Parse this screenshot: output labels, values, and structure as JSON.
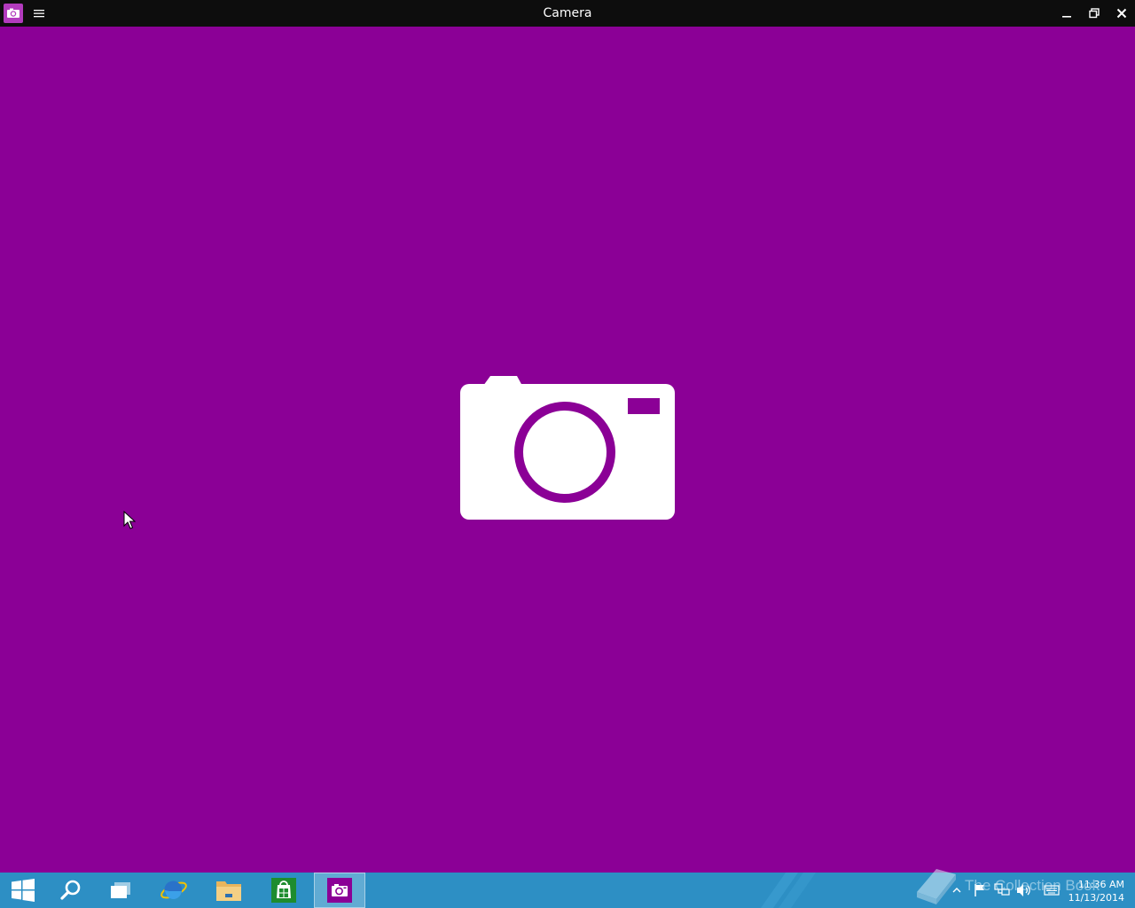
{
  "window": {
    "title": "Camera",
    "icons": {
      "app": "camera-app-icon",
      "menu": "hamburger-menu-icon",
      "minimize": "minimize-icon",
      "maximize": "restore-icon",
      "close": "close-icon"
    }
  },
  "main": {
    "background_color": "#8b0096",
    "placeholder_icon": "camera-icon"
  },
  "taskbar": {
    "color": "#2d8fc4",
    "items": [
      {
        "name": "start",
        "icon": "windows-logo-icon"
      },
      {
        "name": "search",
        "icon": "search-icon"
      },
      {
        "name": "task-view",
        "icon": "task-view-icon"
      },
      {
        "name": "internet-explorer",
        "icon": "internet-explorer-icon"
      },
      {
        "name": "file-explorer",
        "icon": "folder-icon"
      },
      {
        "name": "store",
        "icon": "store-icon"
      },
      {
        "name": "camera",
        "icon": "camera-icon",
        "active": true
      }
    ],
    "tray": {
      "icons": [
        "show-hidden-icons-arrow",
        "action-center-flag-icon",
        "network-icon",
        "volume-icon",
        "keyboard-icon"
      ],
      "time": "11:36 AM",
      "date": "11/13/2014"
    }
  },
  "watermark": {
    "text": "The Collection Book"
  }
}
